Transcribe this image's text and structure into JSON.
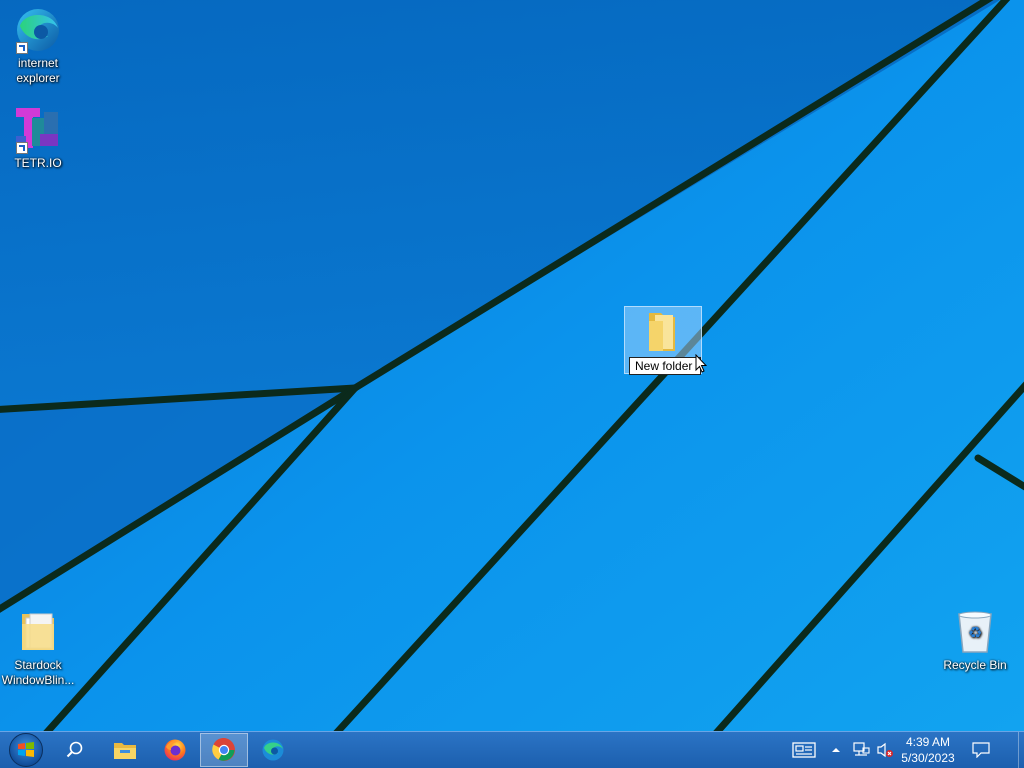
{
  "desktop": {
    "icons": [
      {
        "label_line1": "internet",
        "label_line2": "explorer",
        "icon": "edge-icon"
      },
      {
        "label_line1": "TETR.IO",
        "label_line2": "",
        "icon": "tetrio-icon"
      },
      {
        "label_line1": "Stardock",
        "label_line2": "WindowBlin...",
        "icon": "folder-icon"
      },
      {
        "label_line1": "Recycle Bin",
        "label_line2": "",
        "icon": "recycle-bin-icon"
      }
    ],
    "selected_folder": {
      "rename_value": "New folder",
      "icon": "folder-icon"
    }
  },
  "taskbar": {
    "start_icon": "windows-start-icon",
    "pinned": [
      "search-icon",
      "file-explorer-icon",
      "firefox-icon",
      "chrome-icon",
      "edge-icon"
    ],
    "active_app": "chrome-icon"
  },
  "tray": {
    "icons": [
      "news-icon",
      "show-hidden-icons-chevron",
      "network-icon",
      "volume-muted-icon",
      "notification-icon"
    ],
    "time": "4:39 AM",
    "date": "5/30/2023"
  },
  "colors": {
    "wallpaper_blue": "#0a8ee8",
    "taskbar_blue": "#1f66b8",
    "line_color": "#0b2a1c"
  }
}
